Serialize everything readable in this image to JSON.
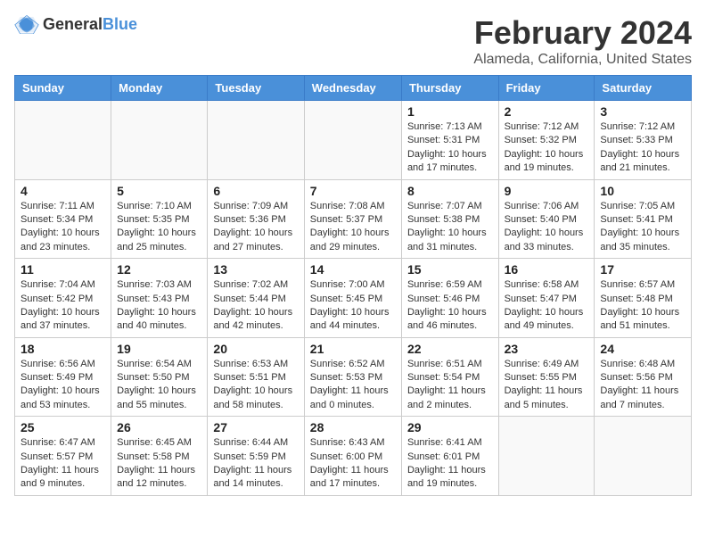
{
  "logo": {
    "general": "General",
    "blue": "Blue"
  },
  "title": {
    "month_year": "February 2024",
    "location": "Alameda, California, United States"
  },
  "headers": [
    "Sunday",
    "Monday",
    "Tuesday",
    "Wednesday",
    "Thursday",
    "Friday",
    "Saturday"
  ],
  "weeks": [
    [
      {
        "day": "",
        "info": ""
      },
      {
        "day": "",
        "info": ""
      },
      {
        "day": "",
        "info": ""
      },
      {
        "day": "",
        "info": ""
      },
      {
        "day": "1",
        "info": "Sunrise: 7:13 AM\nSunset: 5:31 PM\nDaylight: 10 hours\nand 17 minutes."
      },
      {
        "day": "2",
        "info": "Sunrise: 7:12 AM\nSunset: 5:32 PM\nDaylight: 10 hours\nand 19 minutes."
      },
      {
        "day": "3",
        "info": "Sunrise: 7:12 AM\nSunset: 5:33 PM\nDaylight: 10 hours\nand 21 minutes."
      }
    ],
    [
      {
        "day": "4",
        "info": "Sunrise: 7:11 AM\nSunset: 5:34 PM\nDaylight: 10 hours\nand 23 minutes."
      },
      {
        "day": "5",
        "info": "Sunrise: 7:10 AM\nSunset: 5:35 PM\nDaylight: 10 hours\nand 25 minutes."
      },
      {
        "day": "6",
        "info": "Sunrise: 7:09 AM\nSunset: 5:36 PM\nDaylight: 10 hours\nand 27 minutes."
      },
      {
        "day": "7",
        "info": "Sunrise: 7:08 AM\nSunset: 5:37 PM\nDaylight: 10 hours\nand 29 minutes."
      },
      {
        "day": "8",
        "info": "Sunrise: 7:07 AM\nSunset: 5:38 PM\nDaylight: 10 hours\nand 31 minutes."
      },
      {
        "day": "9",
        "info": "Sunrise: 7:06 AM\nSunset: 5:40 PM\nDaylight: 10 hours\nand 33 minutes."
      },
      {
        "day": "10",
        "info": "Sunrise: 7:05 AM\nSunset: 5:41 PM\nDaylight: 10 hours\nand 35 minutes."
      }
    ],
    [
      {
        "day": "11",
        "info": "Sunrise: 7:04 AM\nSunset: 5:42 PM\nDaylight: 10 hours\nand 37 minutes."
      },
      {
        "day": "12",
        "info": "Sunrise: 7:03 AM\nSunset: 5:43 PM\nDaylight: 10 hours\nand 40 minutes."
      },
      {
        "day": "13",
        "info": "Sunrise: 7:02 AM\nSunset: 5:44 PM\nDaylight: 10 hours\nand 42 minutes."
      },
      {
        "day": "14",
        "info": "Sunrise: 7:00 AM\nSunset: 5:45 PM\nDaylight: 10 hours\nand 44 minutes."
      },
      {
        "day": "15",
        "info": "Sunrise: 6:59 AM\nSunset: 5:46 PM\nDaylight: 10 hours\nand 46 minutes."
      },
      {
        "day": "16",
        "info": "Sunrise: 6:58 AM\nSunset: 5:47 PM\nDaylight: 10 hours\nand 49 minutes."
      },
      {
        "day": "17",
        "info": "Sunrise: 6:57 AM\nSunset: 5:48 PM\nDaylight: 10 hours\nand 51 minutes."
      }
    ],
    [
      {
        "day": "18",
        "info": "Sunrise: 6:56 AM\nSunset: 5:49 PM\nDaylight: 10 hours\nand 53 minutes."
      },
      {
        "day": "19",
        "info": "Sunrise: 6:54 AM\nSunset: 5:50 PM\nDaylight: 10 hours\nand 55 minutes."
      },
      {
        "day": "20",
        "info": "Sunrise: 6:53 AM\nSunset: 5:51 PM\nDaylight: 10 hours\nand 58 minutes."
      },
      {
        "day": "21",
        "info": "Sunrise: 6:52 AM\nSunset: 5:53 PM\nDaylight: 11 hours\nand 0 minutes."
      },
      {
        "day": "22",
        "info": "Sunrise: 6:51 AM\nSunset: 5:54 PM\nDaylight: 11 hours\nand 2 minutes."
      },
      {
        "day": "23",
        "info": "Sunrise: 6:49 AM\nSunset: 5:55 PM\nDaylight: 11 hours\nand 5 minutes."
      },
      {
        "day": "24",
        "info": "Sunrise: 6:48 AM\nSunset: 5:56 PM\nDaylight: 11 hours\nand 7 minutes."
      }
    ],
    [
      {
        "day": "25",
        "info": "Sunrise: 6:47 AM\nSunset: 5:57 PM\nDaylight: 11 hours\nand 9 minutes."
      },
      {
        "day": "26",
        "info": "Sunrise: 6:45 AM\nSunset: 5:58 PM\nDaylight: 11 hours\nand 12 minutes."
      },
      {
        "day": "27",
        "info": "Sunrise: 6:44 AM\nSunset: 5:59 PM\nDaylight: 11 hours\nand 14 minutes."
      },
      {
        "day": "28",
        "info": "Sunrise: 6:43 AM\nSunset: 6:00 PM\nDaylight: 11 hours\nand 17 minutes."
      },
      {
        "day": "29",
        "info": "Sunrise: 6:41 AM\nSunset: 6:01 PM\nDaylight: 11 hours\nand 19 minutes."
      },
      {
        "day": "",
        "info": ""
      },
      {
        "day": "",
        "info": ""
      }
    ]
  ]
}
